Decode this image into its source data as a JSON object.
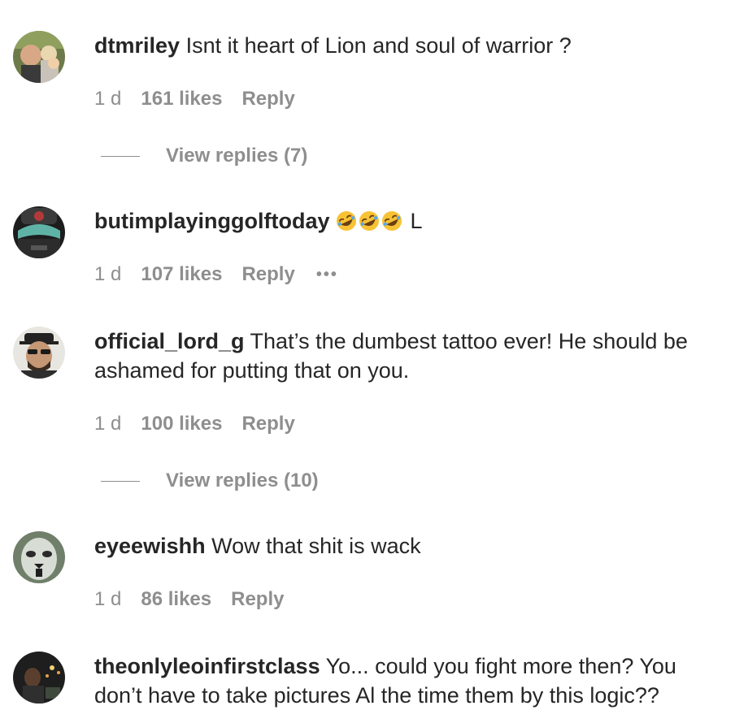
{
  "comments": [
    {
      "username": "dtmriley",
      "text": "Isnt it heart of Lion and soul of warrior ?",
      "age": "1 d",
      "likes": "161 likes",
      "reply": "Reply",
      "view_replies": "View replies (7)"
    },
    {
      "username": "butimplayinggolftoday",
      "emoji": [
        "rolling-on-floor-laughing-emoji",
        "rolling-on-floor-laughing-emoji",
        "rolling-on-floor-laughing-emoji"
      ],
      "text": "L",
      "age": "1 d",
      "likes": "107 likes",
      "reply": "Reply",
      "more": "•••"
    },
    {
      "username": "official_lord_g",
      "text": "That’s the dumbest tattoo ever! He should be ashamed for putting that on you.",
      "age": "1 d",
      "likes": "100 likes",
      "reply": "Reply",
      "view_replies": "View replies (10)"
    },
    {
      "username": "eyeewishh",
      "text": "Wow that shit is wack",
      "age": "1 d",
      "likes": "86 likes",
      "reply": "Reply"
    },
    {
      "username": "theonlyleoinfirstclass",
      "text": "Yo... could you fight more then? You don’t have to take pictures Al the time them by this logic??"
    }
  ],
  "colors": {
    "text": "#262626",
    "secondary": "#8e8e8e",
    "background": "#ffffff"
  }
}
